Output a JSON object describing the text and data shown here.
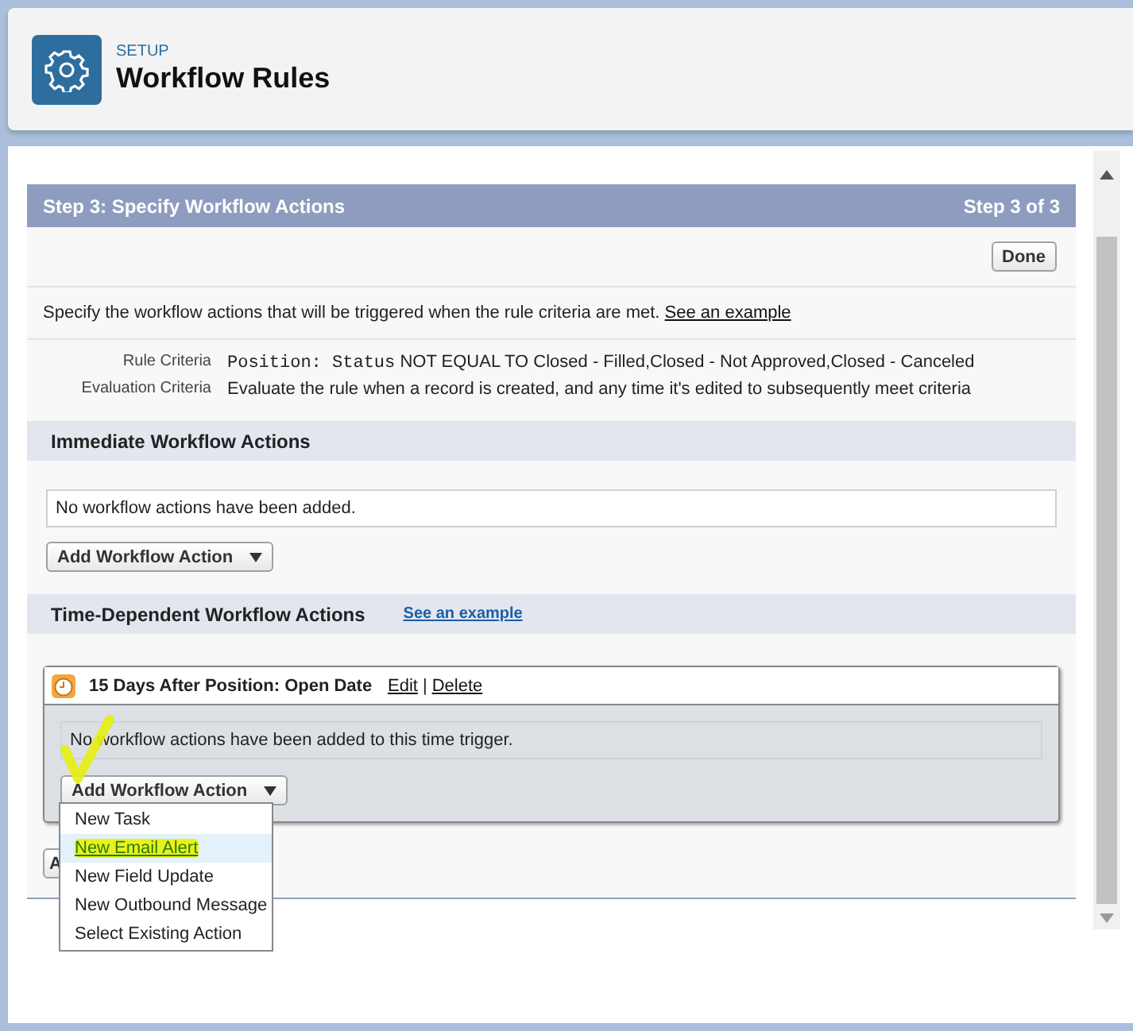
{
  "header": {
    "breadcrumb": "SETUP",
    "title": "Workflow Rules"
  },
  "step": {
    "title": "Step 3: Specify Workflow Actions",
    "counter": "Step 3 of 3",
    "done_button": "Done",
    "description": "Specify the workflow actions that will be triggered when the rule criteria are met.",
    "description_link": "See an example",
    "criteria": [
      {
        "label": "Rule Criteria",
        "kind": "rule",
        "field": "Position: Status",
        "operator": "NOT EQUAL TO",
        "value": "Closed - Filled,Closed - Not Approved,Closed - Canceled"
      },
      {
        "label": "Evaluation Criteria",
        "kind": "text",
        "value": "Evaluate the rule when a record is created, and any time it's edited to subsequently meet criteria"
      }
    ]
  },
  "immediate": {
    "title": "Immediate Workflow Actions",
    "empty_message": "No workflow actions have been added.",
    "add_button": "Add Workflow Action"
  },
  "time_dependent": {
    "title": "Time-Dependent Workflow Actions",
    "link": "See an example",
    "triggers": [
      {
        "title": "15 Days After Position: Open Date",
        "edit": "Edit",
        "separator": "|",
        "delete": "Delete",
        "empty_message": "No workflow actions have been added to this time trigger.",
        "add_button": "Add Workflow Action",
        "menu": [
          {
            "label": "New Task",
            "selected": false,
            "highlighted": false
          },
          {
            "label": "New Email Alert",
            "selected": true,
            "highlighted": true
          },
          {
            "label": "New Field Update",
            "selected": false,
            "highlighted": false
          },
          {
            "label": "New Outbound Message",
            "selected": false,
            "highlighted": false
          },
          {
            "label": "Select Existing Action",
            "selected": false,
            "highlighted": false
          }
        ]
      }
    ],
    "add_button": "A"
  }
}
